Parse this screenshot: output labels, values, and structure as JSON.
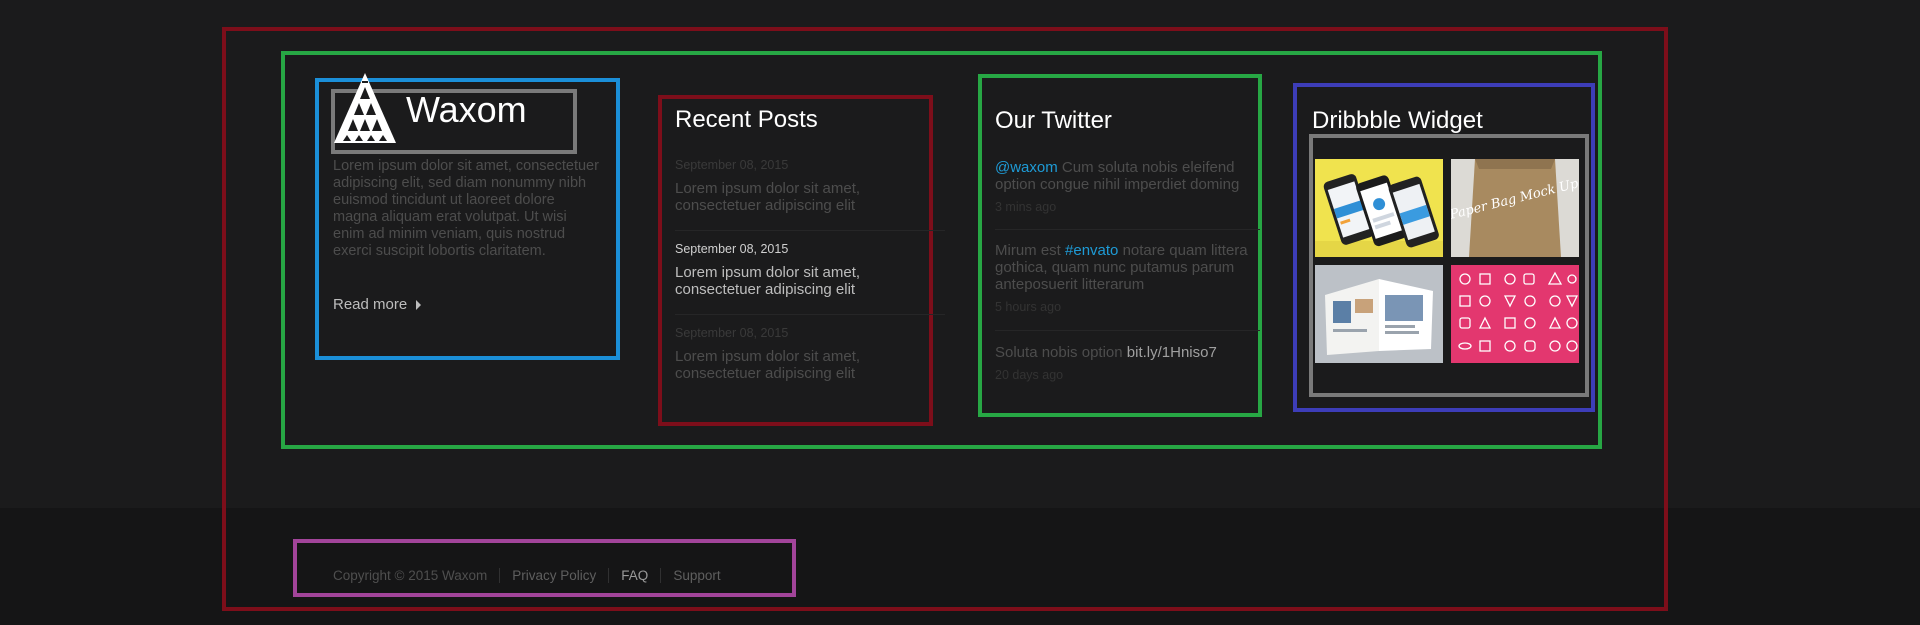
{
  "brand": {
    "name": "Waxom"
  },
  "about": {
    "text": "Lorem ipsum dolor sit amet, consectetuer adipiscing elit, sed diam nonummy nibh euismod tincidunt ut laoreet dolore magna aliquam erat volutpat. Ut wisi enim ad minim veniam, quis nostrud exerci suscipit lobortis claritatem.",
    "read_more": "Read more"
  },
  "recent_posts": {
    "title": "Recent Posts",
    "items": [
      {
        "date": "September 08, 2015",
        "text": "Lorem ipsum dolor sit amet, consectetuer adipiscing elit"
      },
      {
        "date": "September 08, 2015",
        "text": "Lorem ipsum dolor sit amet, consectetuer adipiscing elit"
      },
      {
        "date": "September 08, 2015",
        "text": "Lorem ipsum dolor sit amet, consectetuer adipiscing elit"
      }
    ]
  },
  "twitter": {
    "title": "Our Twitter",
    "tweets": [
      {
        "link": "@waxom",
        "text": " Cum soluta nobis eleifend option congue nihil imperdiet doming",
        "time": "3 mins ago"
      },
      {
        "pre": "Mirum est ",
        "link": "#envato",
        "text": " notare quam littera gothica, quam nunc putamus parum anteposuerit litterarum",
        "time": "5 hours ago"
      },
      {
        "text": "Soluta nobis option ",
        "url": "bit.ly/1Hniso7",
        "time": "20 days ago"
      }
    ]
  },
  "dribbble": {
    "title": "Dribbble Widget",
    "thumb_text": "Paper Bag Mock Up"
  },
  "footer": {
    "copyright": "Copyright © 2015 Waxom",
    "links": [
      "Privacy Policy",
      "FAQ",
      "Support"
    ]
  },
  "colors": {
    "accent": "#1e9bd6",
    "pink": "#e3376f",
    "yellow": "#f0e34e"
  }
}
